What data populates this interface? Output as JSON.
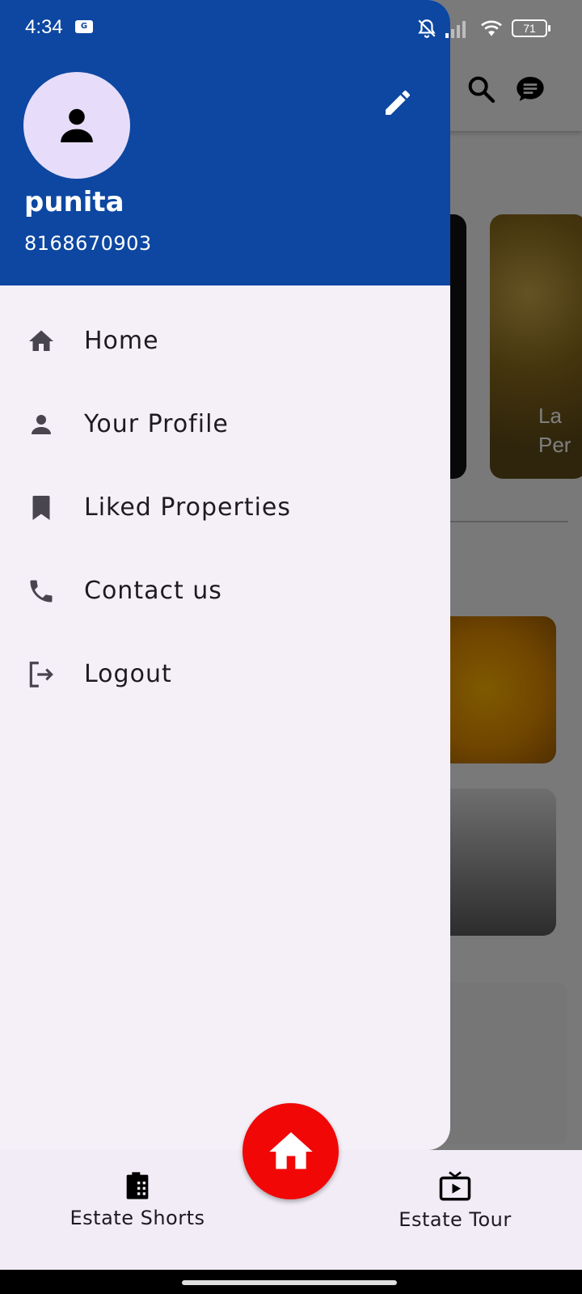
{
  "status_bar": {
    "time": "4:34",
    "sim_badge": "G",
    "battery": "71",
    "icons": [
      "bell-off-icon",
      "signal-icon",
      "wifi-icon",
      "battery-icon"
    ]
  },
  "background": {
    "card_text": "La\nPer",
    "icons": [
      "search-icon",
      "chat-icon"
    ]
  },
  "drawer": {
    "user": {
      "name": "punita",
      "phone": "8168670903",
      "avatar_icon": "person-icon",
      "edit_icon": "pencil-icon"
    },
    "menu": [
      {
        "label": "Home",
        "icon": "home-icon"
      },
      {
        "label": "Your Profile",
        "icon": "person-icon"
      },
      {
        "label": "Liked Properties",
        "icon": "bookmark-icon"
      },
      {
        "label": "Contact us",
        "icon": "phone-icon"
      },
      {
        "label": "Logout",
        "icon": "logout-icon"
      }
    ],
    "colors": {
      "header": "#0d47a1",
      "background": "#f5f0f8"
    }
  },
  "bottom_nav": {
    "items": [
      {
        "label": "Estate Shorts",
        "icon": "film-reel-icon"
      },
      {
        "label": "Estate Tour",
        "icon": "tv-play-icon"
      }
    ],
    "fab_icon": "home-icon",
    "fab_color": "#f20707"
  }
}
